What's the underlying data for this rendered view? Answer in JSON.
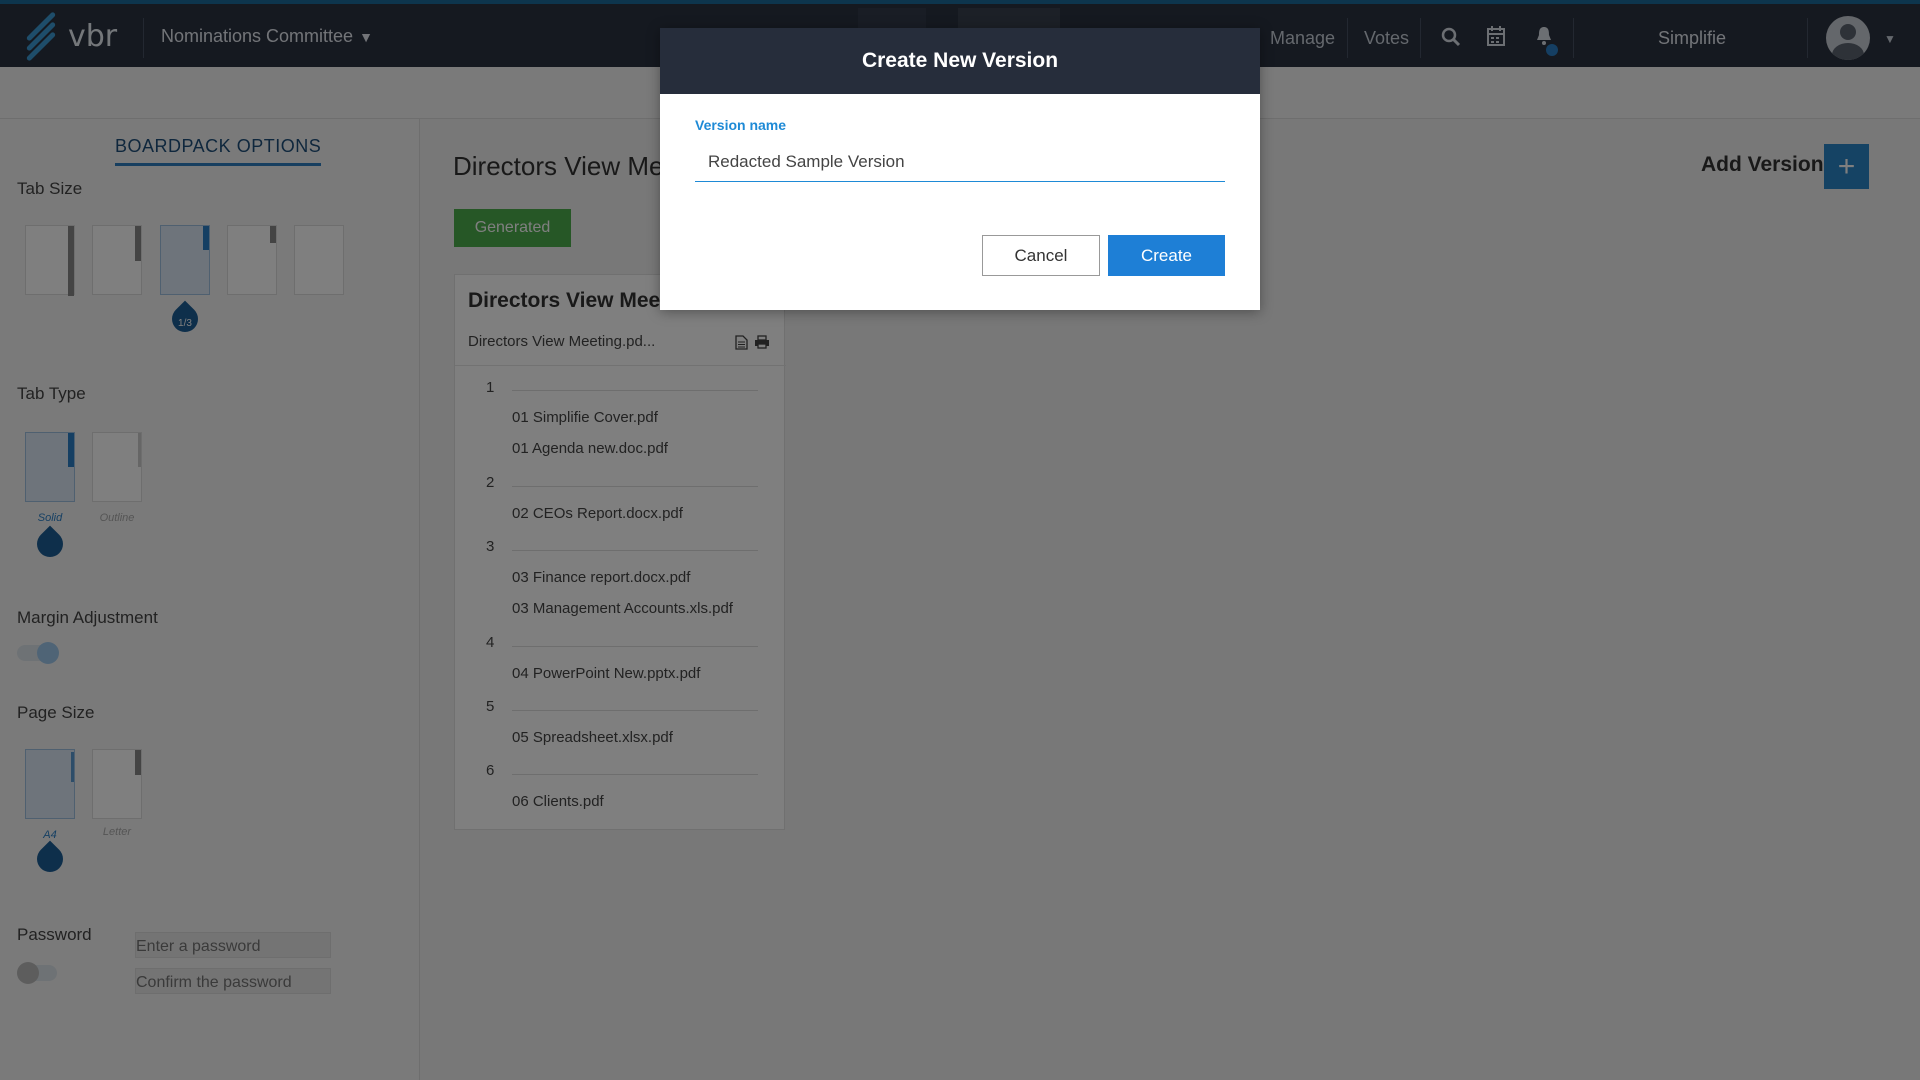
{
  "app": {
    "logo_text": "vbr",
    "committee": "Nominations Committee",
    "org": "Simplifie"
  },
  "nav": {
    "links": [
      "Manage",
      "Votes"
    ]
  },
  "left_panel": {
    "title": "BOARDPACK OPTIONS",
    "tab_size": {
      "label": "Tab Size",
      "selected_value": "1/3"
    },
    "tab_type": {
      "label": "Tab Type",
      "options": [
        "Solid",
        "Outline"
      ]
    },
    "margin": {
      "label": "Margin Adjustment"
    },
    "page_size": {
      "label": "Page Size",
      "options": [
        "A4",
        "Letter"
      ]
    },
    "password": {
      "label": "Password",
      "placeholder": "Enter a password",
      "confirm_placeholder": "Confirm the password"
    }
  },
  "main": {
    "title": "Directors View Me",
    "status": "Generated",
    "add_version": "Add Version",
    "add_icon": "+",
    "card": {
      "title": "Directors View Meet",
      "file": "Directors View Meeting.pd...",
      "sections": [
        {
          "num": "1",
          "items": [
            "01 Simplifie Cover.pdf",
            "01 Agenda new.doc.pdf"
          ]
        },
        {
          "num": "2",
          "items": [
            "02 CEOs Report.docx.pdf"
          ]
        },
        {
          "num": "3",
          "items": [
            "03 Finance report.docx.pdf",
            "03 Management Accounts.xls.pdf"
          ]
        },
        {
          "num": "4",
          "items": [
            "04 PowerPoint New.pptx.pdf"
          ]
        },
        {
          "num": "5",
          "items": [
            "05 Spreadsheet.xlsx.pdf"
          ]
        },
        {
          "num": "6",
          "items": [
            "06 Clients.pdf"
          ]
        }
      ]
    }
  },
  "modal": {
    "title": "Create New Version",
    "field_label": "Version name",
    "field_value": "Redacted Sample Version",
    "cancel": "Cancel",
    "create": "Create"
  },
  "icons": [
    "logo-icon",
    "chevron-down-icon",
    "search-icon",
    "calendar-icon",
    "bell-icon",
    "avatar-icon",
    "caret-down-icon",
    "document-icon",
    "print-icon",
    "plus-icon"
  ],
  "colors": {
    "accent": "#1e7fd6",
    "nav_bg": "#2b3240",
    "generated_green": "#4cae4c"
  }
}
